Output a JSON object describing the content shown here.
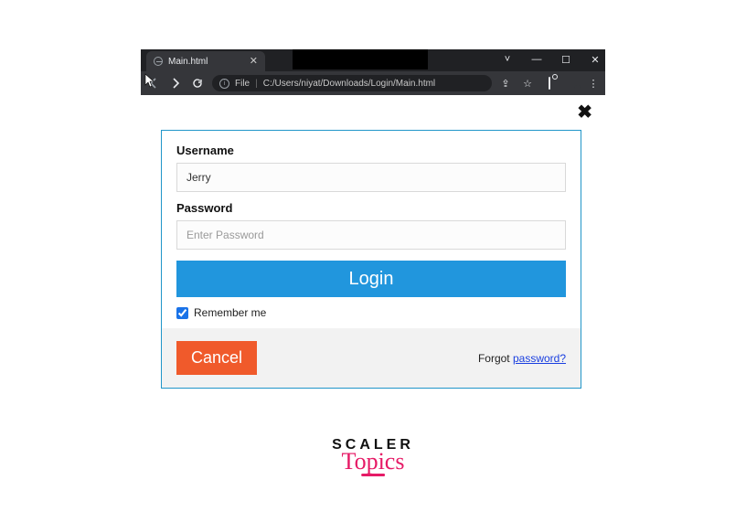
{
  "browser": {
    "tab_title": "Main.html",
    "url_prefix": "File",
    "url_path": "C:/Users/niyat/Downloads/Login/Main.html"
  },
  "window_controls": {
    "minimize_glyph": "—",
    "maximize_glyph": "☐",
    "close_glyph": "✕"
  },
  "toolbar_icons": {
    "share_glyph": "⇪",
    "star_glyph": "☆",
    "menu_glyph": "⋮"
  },
  "modal": {
    "close_glyph": "✖"
  },
  "form": {
    "username_label": "Username",
    "username_value": "Jerry",
    "password_label": "Password",
    "password_placeholder": "Enter Password",
    "login_label": "Login",
    "remember_label": "Remember me",
    "remember_checked": true,
    "cancel_label": "Cancel",
    "forgot_prefix": "Forgot ",
    "forgot_link": "password?"
  },
  "brand": {
    "line1": "SCALER",
    "line2": "Topics"
  }
}
